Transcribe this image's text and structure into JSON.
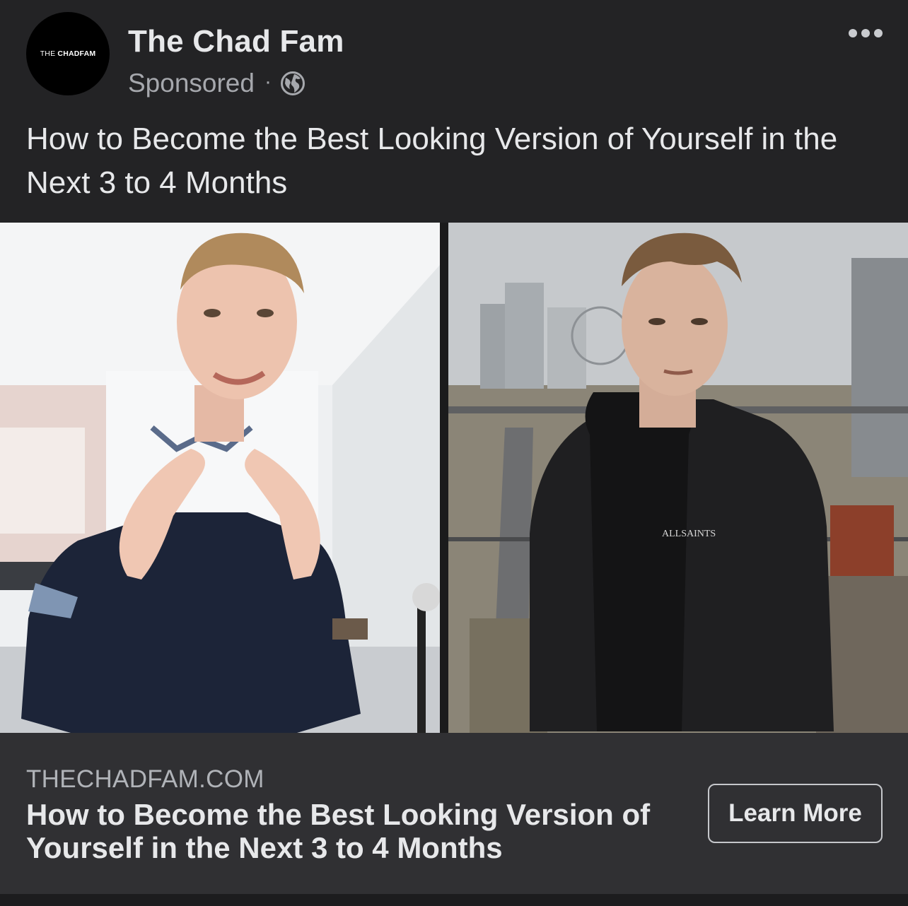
{
  "header": {
    "avatar_text_light": "THE ",
    "avatar_text_bold": "CHAD",
    "avatar_text_tail": "FAM",
    "page_name": "The Chad Fam",
    "sponsored_label": "Sponsored",
    "separator": "·",
    "privacy_icon": "globe-icon",
    "menu_icon": "more-horizontal-icon"
  },
  "caption": "How to Become the Best Looking Version of Yourself in the Next 3 to 4 Months",
  "media": {
    "left_photo": "man-in-blue-polo-gesturing-indoors",
    "right_photo": "man-in-black-jacket-on-balcony-city-view",
    "shirt_print": "ALLSAINTS"
  },
  "link_preview": {
    "domain": "THECHADFAM.COM",
    "title": "How to Become the Best Looking Version of Yourself in the Next 3 to 4 Months",
    "cta_label": "Learn More"
  },
  "colors": {
    "background": "#232325",
    "link_bar": "#303033",
    "text_primary": "#e7e8ea",
    "text_secondary": "#a6a8ad"
  }
}
